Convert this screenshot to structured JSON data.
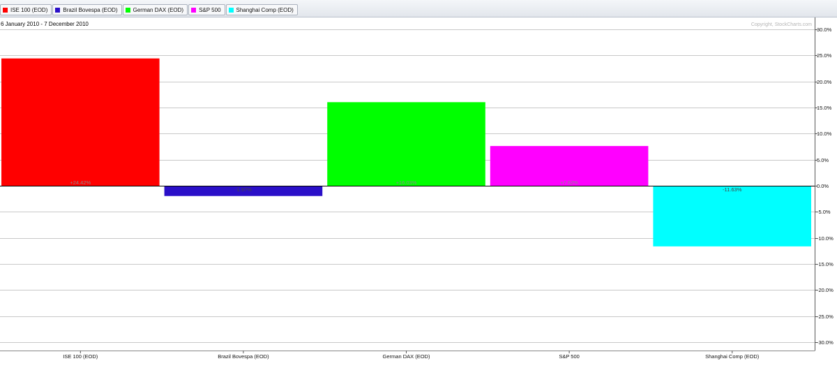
{
  "colors": {
    "ise100": "#ff0000",
    "bovespa": "#2a0fc8",
    "dax": "#00ff00",
    "sp500": "#ff00ff",
    "shanghai": "#00ffff",
    "grid": "#c8c8c8",
    "zero_line": "#000000"
  },
  "legend": [
    {
      "label": "ISE 100 (EOD)",
      "color": "#ff0000"
    },
    {
      "label": "Brazil Bovespa (EOD)",
      "color": "#2a0fc8"
    },
    {
      "label": "German DAX (EOD)",
      "color": "#00ff00"
    },
    {
      "label": "S&P 500",
      "color": "#ff00ff"
    },
    {
      "label": "Shanghai Comp (EOD)",
      "color": "#00ffff"
    }
  ],
  "header": {
    "date_range": "6 January 2010 - 7 December 2010",
    "copyright": "Copyright, StockCharts.com"
  },
  "chart_data": {
    "type": "bar",
    "categories": [
      "ISE 100 (EOD)",
      "Brazil Bovespa (EOD)",
      "German DAX (EOD)",
      "S&P 500",
      "Shanghai Comp (EOD)"
    ],
    "values": [
      24.42,
      -1.97,
      16.03,
      7.62,
      -11.63
    ],
    "value_labels": [
      "+24.42%",
      "-1.97%",
      "+16.03%",
      "+7.62%",
      "-11.63%"
    ],
    "colors": [
      "#ff0000",
      "#2a0fc8",
      "#00ff00",
      "#ff00ff",
      "#00ffff"
    ],
    "ylim": [
      -30,
      30
    ],
    "yticks": [
      30,
      25,
      20,
      15,
      10,
      5,
      0,
      -5,
      -10,
      -15,
      -20,
      -25,
      -30
    ],
    "ytick_labels": [
      "30.0%",
      "25.0%",
      "20.0%",
      "15.0%",
      "10.0%",
      "5.0%",
      "0.0%",
      "-5.0%",
      "-10.0%",
      "-15.0%",
      "-20.0%",
      "-25.0%",
      "-30.0%"
    ],
    "y_axis_position": "right",
    "grid": true
  }
}
